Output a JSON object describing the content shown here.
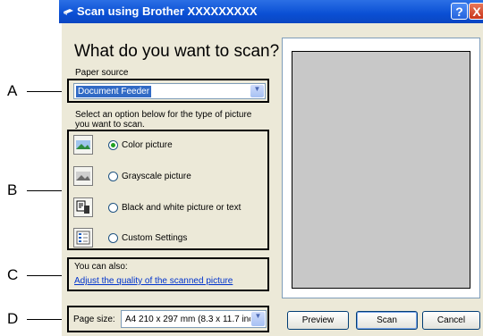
{
  "window": {
    "title": "Scan using Brother XXXXXXXXX"
  },
  "titlebar_buttons": {
    "help": "?",
    "close": "X"
  },
  "main": {
    "heading": "What do you want to scan?",
    "paper_source_label": "Paper source",
    "paper_source_value": "Document Feeder",
    "options_instruction": "Select an option below for the type of picture you want to scan.",
    "options": [
      {
        "label": "Color picture",
        "selected": true,
        "icon": "color-picture-icon"
      },
      {
        "label": "Grayscale picture",
        "selected": false,
        "icon": "grayscale-picture-icon"
      },
      {
        "label": "Black and white picture or text",
        "selected": false,
        "icon": "black-white-picture-icon"
      },
      {
        "label": "Custom Settings",
        "selected": false,
        "icon": "custom-settings-icon"
      }
    ],
    "also_label": "You can also:",
    "adjust_link": "Adjust the quality of the scanned picture",
    "page_size_label": "Page size:",
    "page_size_value": "A4 210 x 297 mm (8.3 x 11.7 inc"
  },
  "buttons": {
    "preview": "Preview",
    "scan": "Scan",
    "cancel": "Cancel"
  },
  "annotations": [
    "A",
    "B",
    "C",
    "D"
  ]
}
